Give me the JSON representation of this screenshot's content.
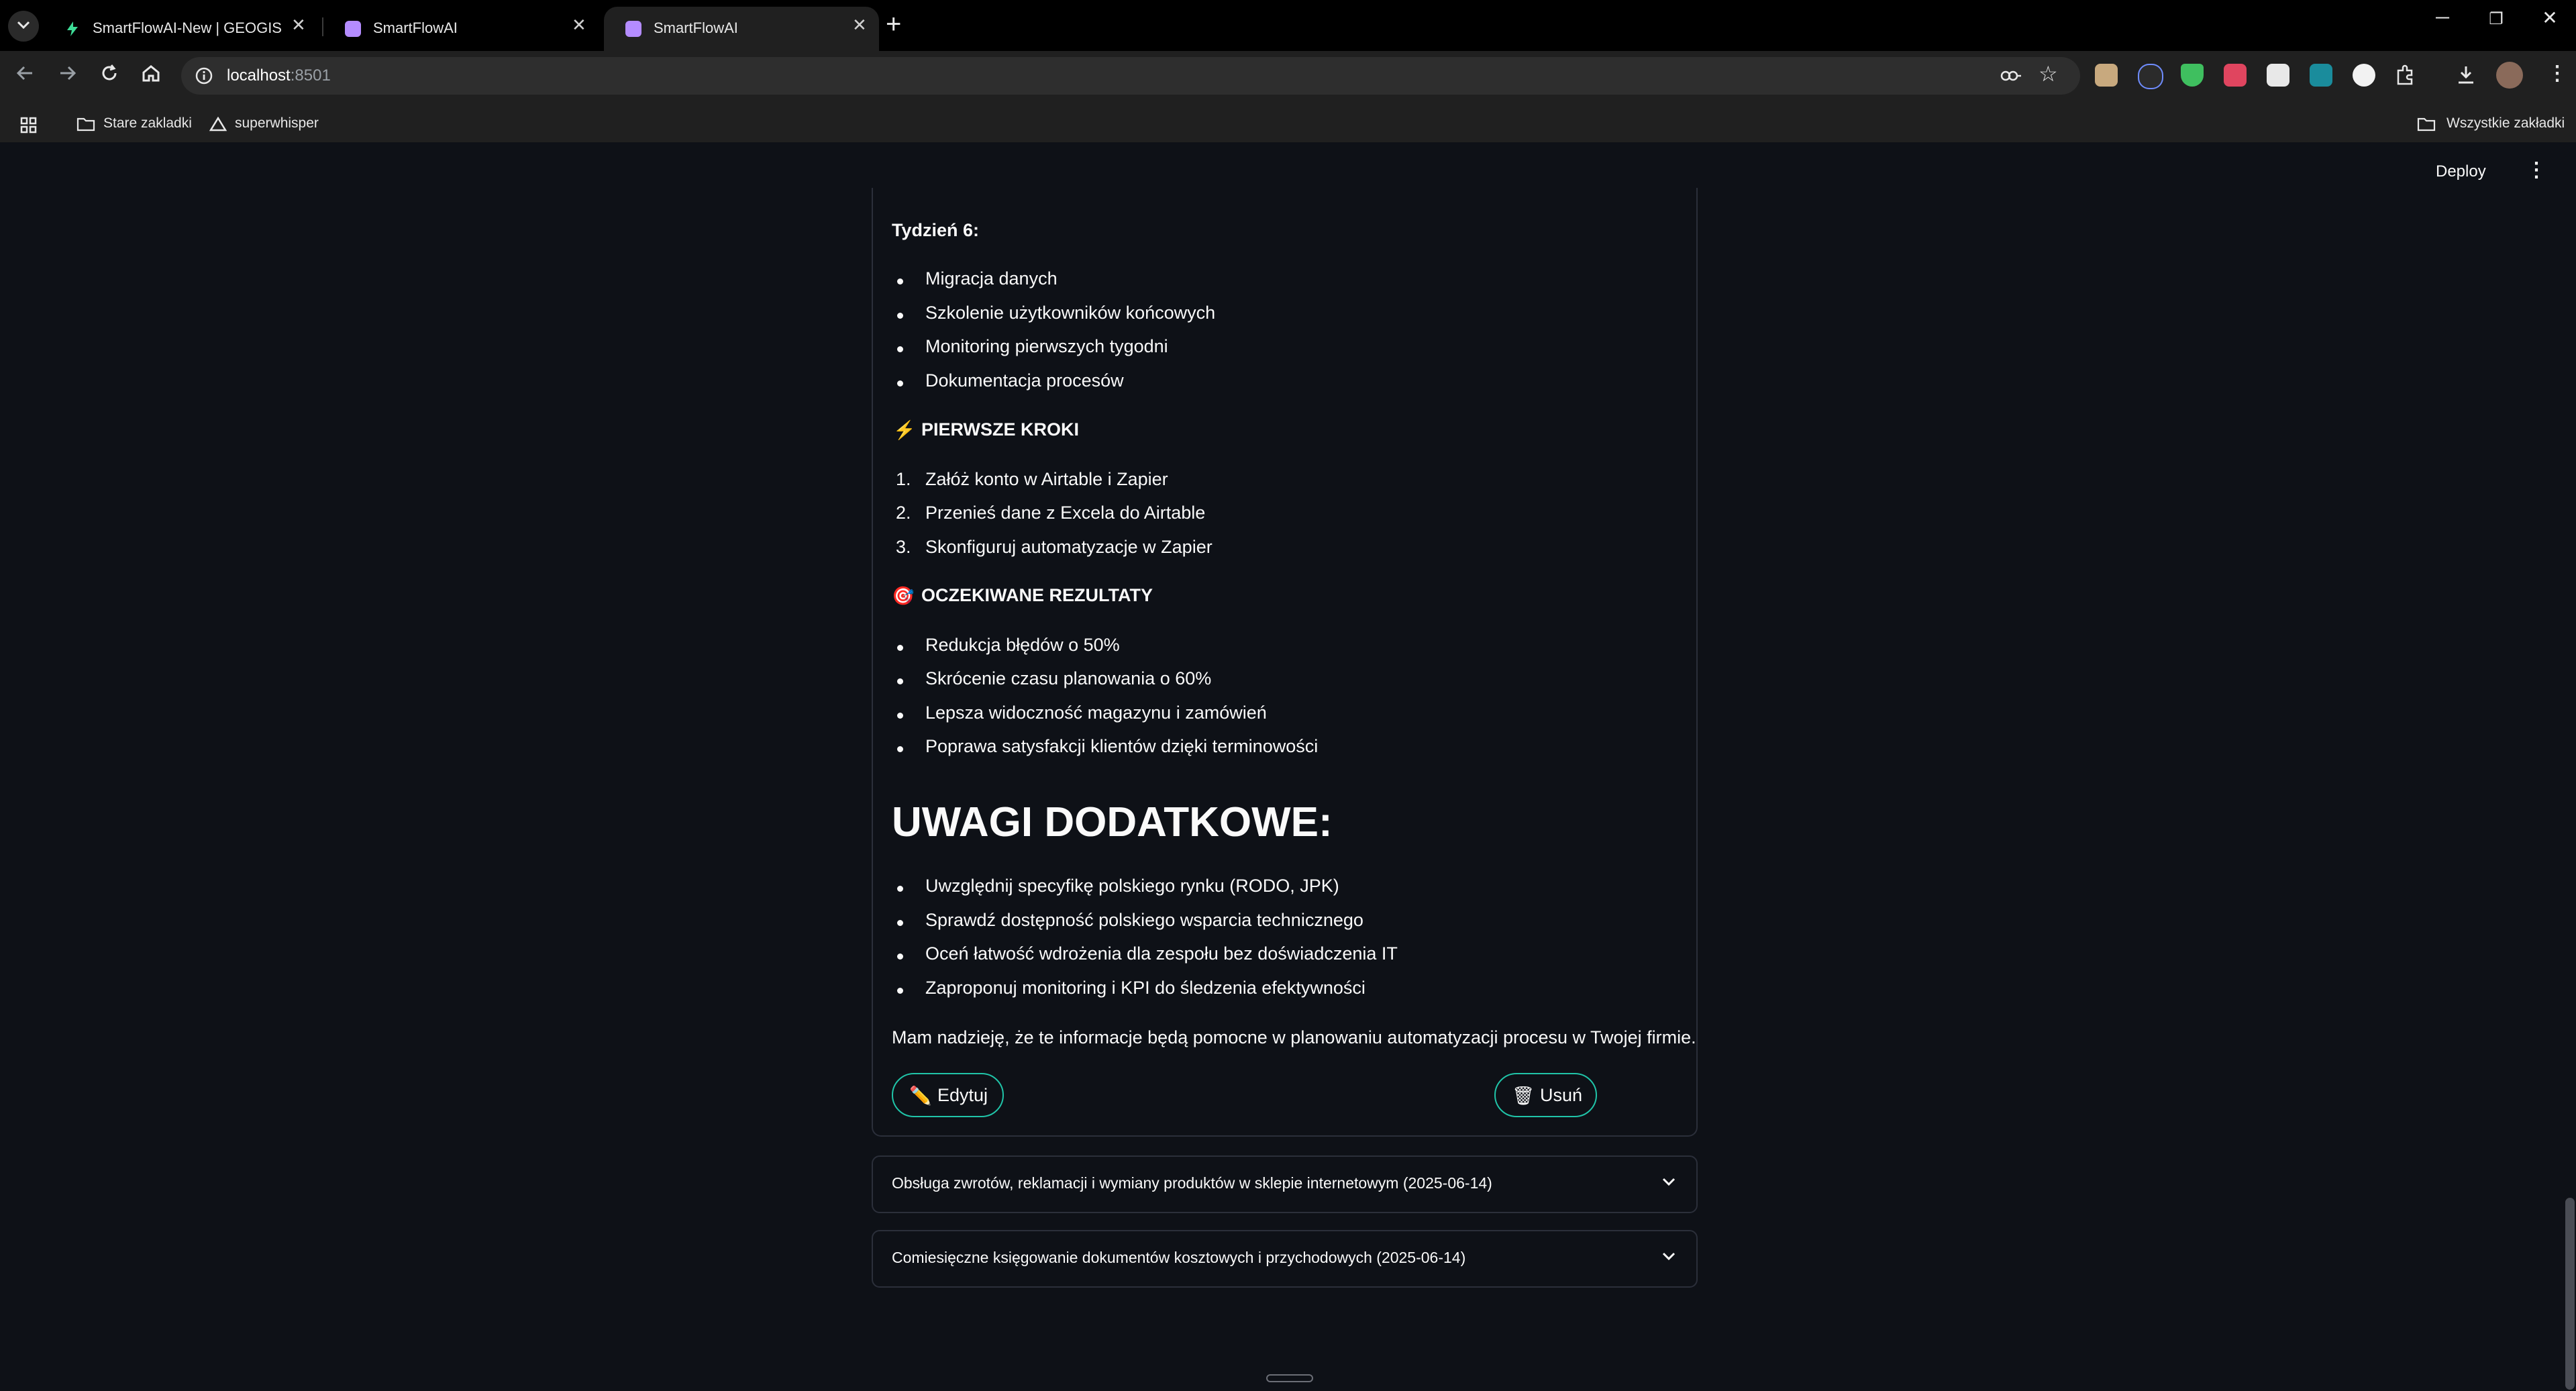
{
  "browser": {
    "tabs": [
      {
        "title": "SmartFlowAI-New | GEOGIS | Su",
        "icon": "lightning-favicon-icon",
        "active": false
      },
      {
        "title": "SmartFlowAI",
        "icon": "smartflow-favicon-icon",
        "active": false
      },
      {
        "title": "SmartFlowAI",
        "icon": "smartflow-favicon-icon",
        "active": true
      }
    ],
    "url_host": "localhost",
    "url_port": ":8501",
    "bookmarks": [
      {
        "label": "Stare zakladki",
        "icon": "folder-icon"
      },
      {
        "label": "superwhisper",
        "icon": "triangle-icon"
      }
    ],
    "all_bookmarks_label": "Wszystkie zakładki"
  },
  "app": {
    "deploy_label": "Deploy",
    "week6": {
      "title": "Tydzień 6:",
      "items": [
        "Migracja danych",
        "Szkolenie użytkowników końcowych",
        "Monitoring pierwszych tygodni",
        "Dokumentacja procesów"
      ]
    },
    "first_steps": {
      "emoji": "⚡",
      "title": "PIERWSZE KROKI",
      "items": [
        "Załóż konto w Airtable i Zapier",
        "Przenieś dane z Excela do Airtable",
        "Skonfiguruj automatyzacje w Zapier"
      ]
    },
    "expected": {
      "emoji": "🎯",
      "title": "OCZEKIWANE REZULTATY",
      "items": [
        "Redukcja błędów o 50%",
        "Skrócenie czasu planowania o 60%",
        "Lepsza widoczność magazynu i zamówień",
        "Poprawa satysfakcji klientów dzięki terminowości"
      ]
    },
    "notes": {
      "heading": "UWAGI DODATKOWE:",
      "items": [
        "Uwzględnij specyfikę polskiego rynku (RODO, JPK)",
        "Sprawdź dostępność polskiego wsparcia technicznego",
        "Oceń łatwość wdrożenia dla zespołu bez doświadczenia IT",
        "Zaproponuj monitoring i KPI do śledzenia efektywności"
      ]
    },
    "closing": "Mam nadzieję, że te informacje będą pomocne w planowaniu automatyzacji procesu w Twojej firmie.",
    "edit_label": "Edytuj",
    "edit_emoji": "✏️",
    "delete_label": "Usuń",
    "delete_emoji": "🗑",
    "expanders": [
      "Obsługa zwrotów, reklamacji i wymiany produktów w sklepie internetowym (2025-06-14)",
      "Comiesięczne księgowanie dokumentów kosztowych i przychodowych (2025-06-14)"
    ]
  }
}
